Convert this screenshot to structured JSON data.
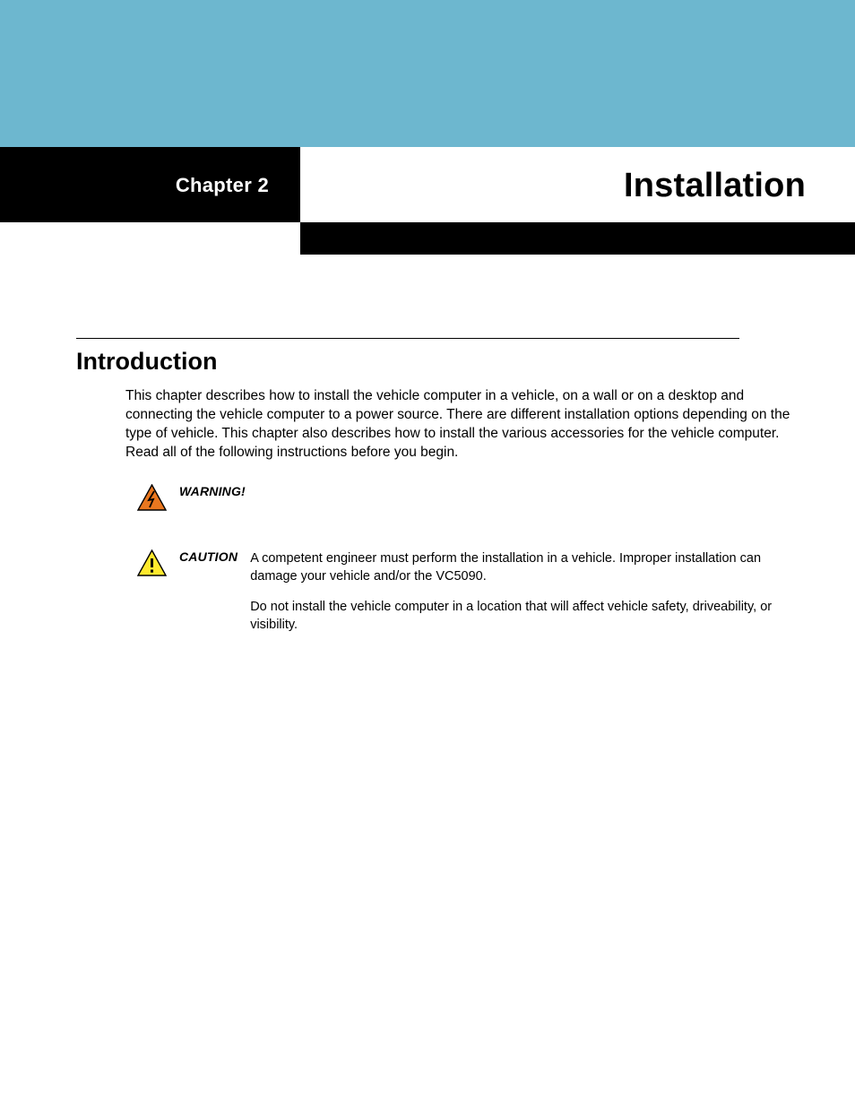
{
  "header": {
    "chapter_label": "Chapter 2",
    "chapter_title": "Installation"
  },
  "section": {
    "heading": "Introduction",
    "intro": "This chapter describes how to install the vehicle computer in a vehicle, on a wall or on a desktop and connecting the vehicle computer to a power source. There are different installation options depending on the type of vehicle. This chapter also describes how to install the various accessories for the vehicle computer. Read all of the following instructions before you begin."
  },
  "notices": {
    "warning": {
      "label": "WARNING!",
      "text": ""
    },
    "caution": {
      "label": "CAUTION",
      "para1": "A competent engineer must perform the installation in a vehicle. Improper installation can damage your vehicle and/or the VC5090.",
      "para2": "Do not install the vehicle computer in a location that will affect vehicle safety, driveability, or visibility."
    }
  },
  "icons": {
    "warning": "warning-triangle-bolt-icon",
    "caution": "caution-triangle-exclamation-icon"
  },
  "colors": {
    "banner_blue": "#6db7cf",
    "warning_fill": "#e9771f",
    "caution_fill": "#ffe92e"
  }
}
